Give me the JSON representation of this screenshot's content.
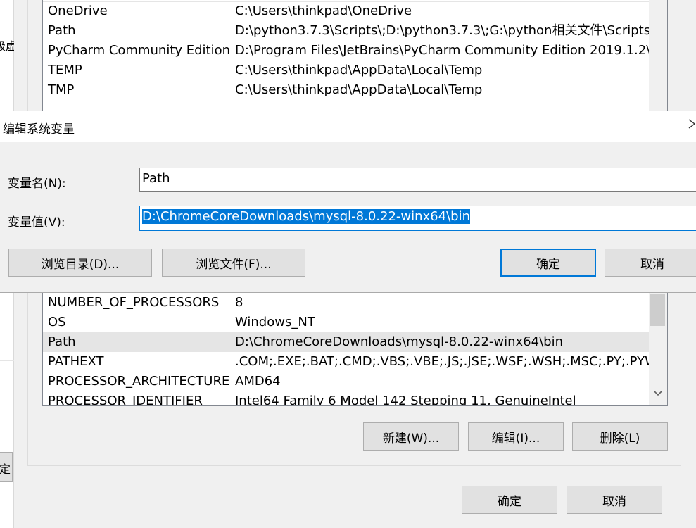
{
  "left_window": {
    "text_1": "级虚",
    "button_label": "定"
  },
  "env_top_list": {
    "rows": [
      {
        "name": "OneDrive",
        "value": "C:\\Users\\thinkpad\\OneDrive"
      },
      {
        "name": "Path",
        "value": "D:\\python3.7.3\\Scripts\\;D:\\python3.7.3\\;G:\\python相关文件\\Scripts..."
      },
      {
        "name": "PyCharm Community Edition",
        "value": "D:\\Program Files\\JetBrains\\PyCharm Community Edition 2019.1.2\\..."
      },
      {
        "name": "TEMP",
        "value": "C:\\Users\\thinkpad\\AppData\\Local\\Temp"
      },
      {
        "name": "TMP",
        "value": "C:\\Users\\thinkpad\\AppData\\Local\\Temp"
      }
    ]
  },
  "dialog": {
    "title": "编辑系统变量",
    "name_label": "变量名(N):",
    "name_value": "Path",
    "value_label": "变量值(V):",
    "value_value": "D:\\ChromeCoreDownloads\\mysql-8.0.22-winx64\\bin",
    "browse_dir": "浏览目录(D)...",
    "browse_file": "浏览文件(F)...",
    "ok": "确定",
    "cancel": "取消"
  },
  "sys_list": {
    "rows": [
      {
        "name": "NUMBER_OF_PROCESSORS",
        "value": "8"
      },
      {
        "name": "OS",
        "value": "Windows_NT"
      },
      {
        "name": "Path",
        "value": "D:\\ChromeCoreDownloads\\mysql-8.0.22-winx64\\bin"
      },
      {
        "name": "PATHEXT",
        "value": ".COM;.EXE;.BAT;.CMD;.VBS;.VBE;.JS;.JSE;.WSF;.WSH;.MSC;.PY;.PYW"
      },
      {
        "name": "PROCESSOR_ARCHITECTURE",
        "value": "AMD64"
      },
      {
        "name": "PROCESSOR_IDENTIFIER",
        "value": "Intel64 Family 6 Model 142 Stepping 11, GenuineIntel"
      }
    ],
    "selected_index": 2,
    "new_button": "新建(W)...",
    "edit_button": "编辑(I)...",
    "delete_button": "删除(L)"
  },
  "footer": {
    "ok": "确定",
    "cancel": "取消"
  },
  "icons": {
    "close": "close-icon",
    "scroll_down": "chevron-down-icon"
  },
  "colors": {
    "accent": "#0078d7",
    "selection": "#e5e5e5"
  }
}
